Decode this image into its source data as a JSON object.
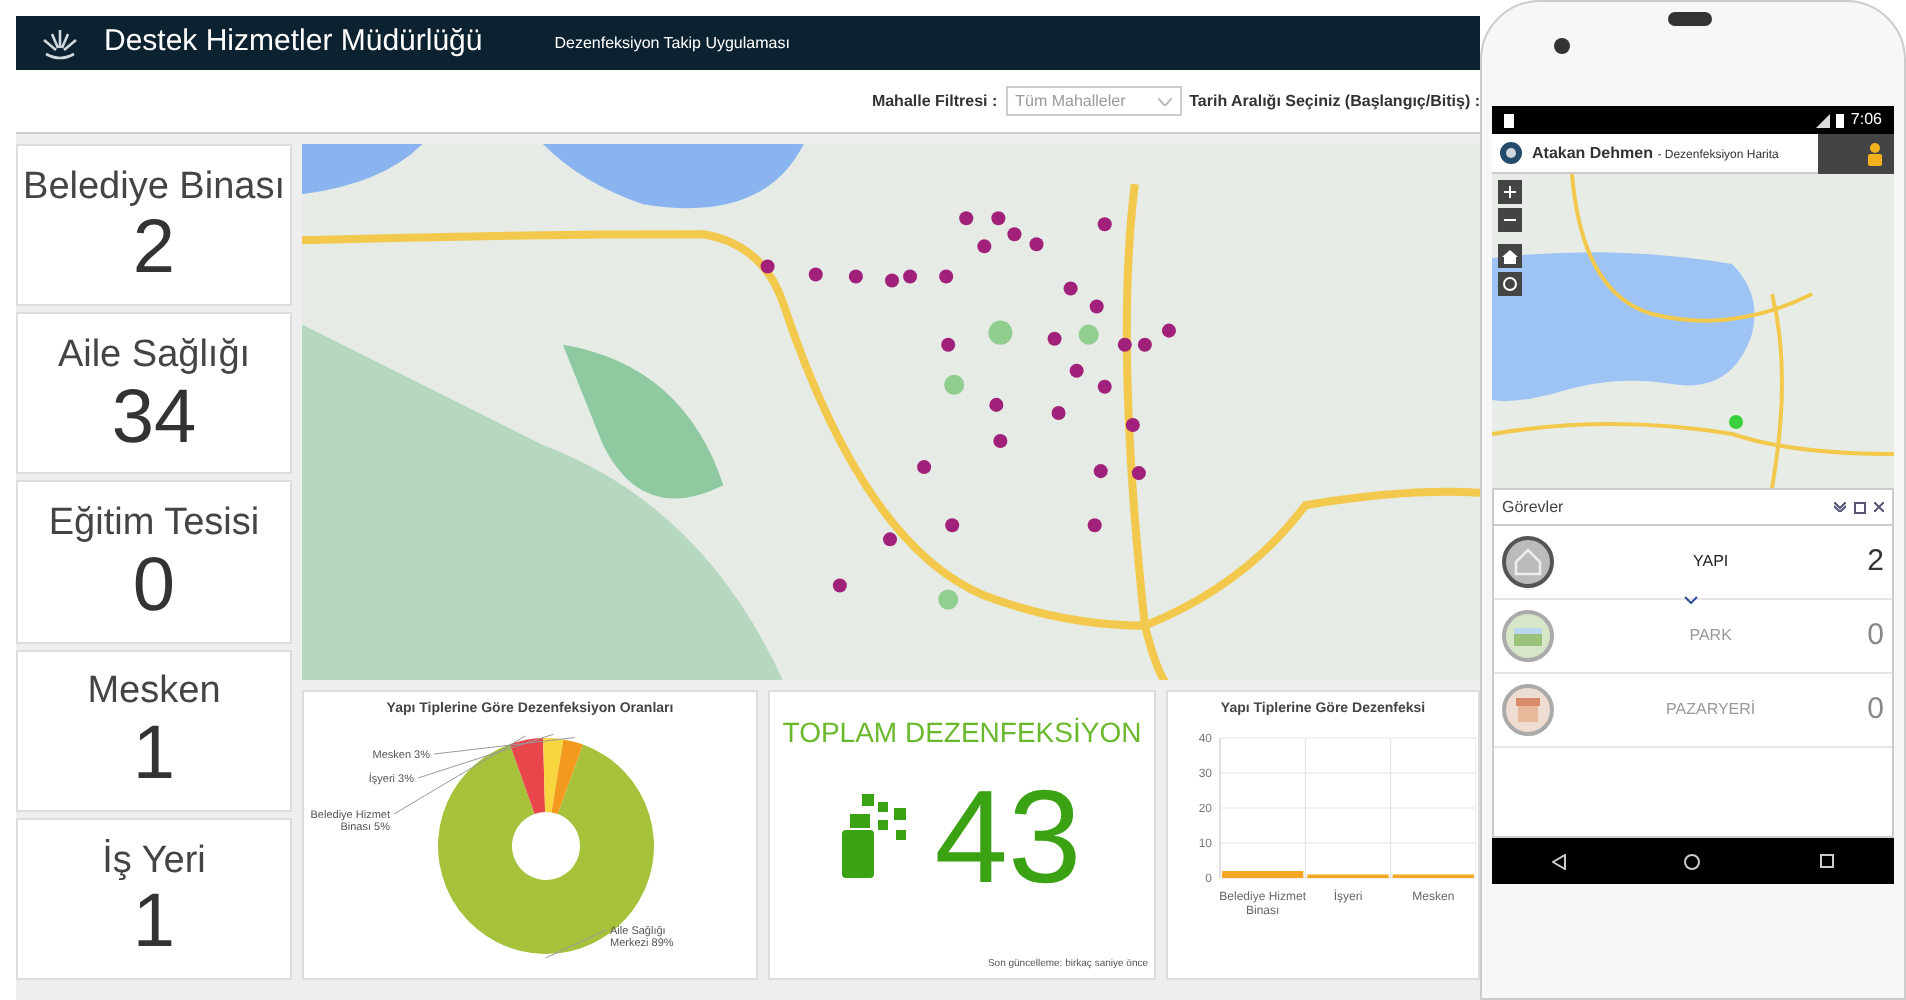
{
  "header": {
    "title": "Destek Hizmetler Müdürlüğü",
    "subtitle": "Dezenfeksiyon Takip Uygulaması"
  },
  "filters": {
    "neighborhood_label": "Mahalle Filtresi :",
    "neighborhood_value": "Tüm Mahalleler",
    "date_label": "Tarih Aralığı Seçiniz (Başlangıç/Bitiş) :"
  },
  "counters": [
    {
      "label": "Belediye Binası",
      "value": "2"
    },
    {
      "label": "Aile Sağlığı",
      "value": "34"
    },
    {
      "label": "Eğitim Tesisi",
      "value": "0"
    },
    {
      "label": "Mesken",
      "value": "1"
    },
    {
      "label": "İş Yeri",
      "value": "1"
    }
  ],
  "pie_panel": {
    "chart_data": {
      "type": "donut",
      "title": "Yapı Tiplerine Göre Dezenfeksiyon Oranları",
      "categories": [
        "Aile Sağlığı Merkezi",
        "Belediye Hizmet Binası",
        "İşyeri",
        "Mesken"
      ],
      "values": [
        89,
        5,
        3,
        3
      ],
      "colors": [
        "#a5c23a",
        "#e9464b",
        "#f8d640",
        "#f39a1e"
      ],
      "value_labels": [
        "89%",
        "5%",
        "3%",
        "3%"
      ]
    }
  },
  "total_panel": {
    "title": "TOPLAM DEZENFEKSİYON",
    "value": "43",
    "footer": "Son güncelleme: birkaç saniye önce"
  },
  "bar_panel": {
    "chart_data": {
      "type": "bar",
      "title": "Yapı Tiplerine Göre Dezenfeksi",
      "categories": [
        "Belediye Hizmet Binası",
        "İşyeri",
        "Mesken"
      ],
      "series": [
        {
          "color": "#f5a623",
          "values": [
            2,
            1,
            1
          ]
        }
      ],
      "ylim": [
        0,
        40
      ],
      "yticks": [
        0,
        10,
        20,
        30,
        40
      ],
      "grid": true
    }
  },
  "phone": {
    "time": "7:06",
    "user": "Atakan Dehmen",
    "app_title": "- Dezenfeksiyon Harita",
    "panel_title": "Görevler",
    "tasks": [
      {
        "kind": "building",
        "label": "YAPI",
        "count": "2",
        "active": true
      },
      {
        "kind": "park",
        "label": "PARK",
        "count": "0",
        "active": false
      },
      {
        "kind": "market",
        "label": "PAZARYERİ",
        "count": "0",
        "active": false
      }
    ]
  }
}
